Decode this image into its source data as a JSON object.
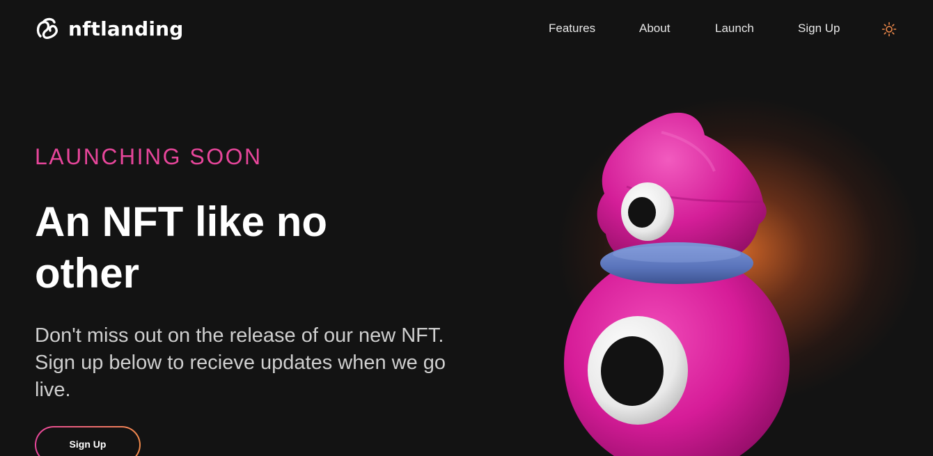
{
  "header": {
    "logo_text": "nftlanding",
    "nav": [
      {
        "label": "Features"
      },
      {
        "label": "About"
      },
      {
        "label": "Launch"
      },
      {
        "label": "Sign Up"
      }
    ],
    "theme_toggle_icon": "sun-icon"
  },
  "hero": {
    "eyebrow": "LAUNCHING SOON",
    "headline": "An NFT like no other",
    "subtext": "Don't miss out on the release of our new NFT. Sign up below to recieve updates when we go live.",
    "cta_label": "Sign Up",
    "image_icon": "pink-one-eyed-character-illustration"
  },
  "colors": {
    "background": "#131313",
    "accent_pink": "#e8469b",
    "accent_orange": "#f08a4b",
    "character_pink": "#d91c9a",
    "collar_blue": "#5d7bc4",
    "text_muted": "#cfcfcf"
  }
}
